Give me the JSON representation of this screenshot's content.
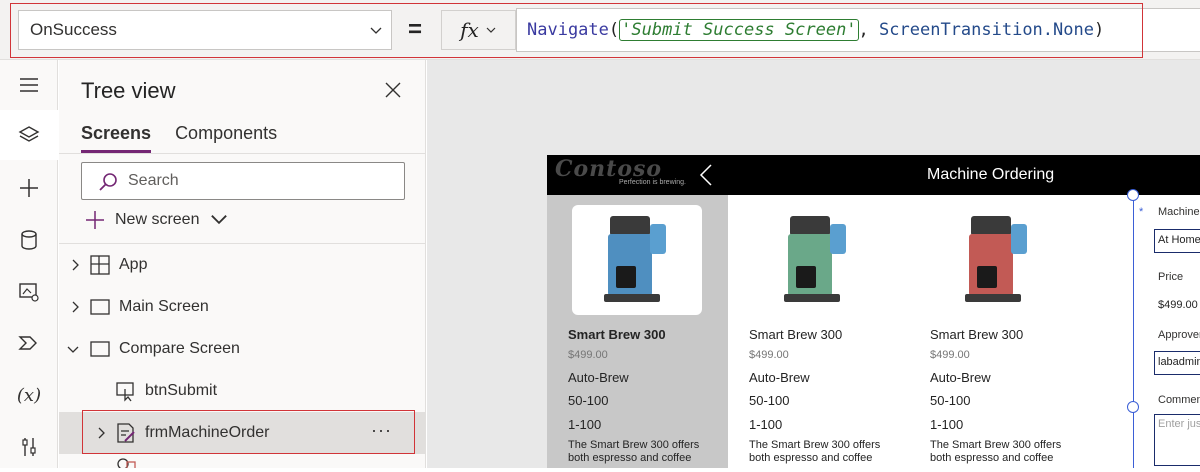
{
  "formula_bar": {
    "property": "OnSuccess",
    "equals": "=",
    "fx_label": "fx",
    "formula": {
      "fn": "Navigate",
      "open": "(",
      "arg1": "'Submit Success Screen'",
      "comma": ", ",
      "arg2": "ScreenTransition.None",
      "close": ")"
    }
  },
  "rail": {
    "items": [
      "menu-icon",
      "layers-icon",
      "plus-icon",
      "database-icon",
      "media-icon",
      "power-automate-icon",
      "variables-icon",
      "tools-icon"
    ],
    "variables_text": "(x)"
  },
  "tree_view": {
    "title": "Tree view",
    "tabs": [
      {
        "label": "Screens"
      },
      {
        "label": "Components"
      }
    ],
    "search_placeholder": "Search",
    "new_screen": "New screen",
    "nodes": [
      {
        "label": "App"
      },
      {
        "label": "Main Screen"
      },
      {
        "label": "Compare Screen"
      },
      {
        "label": "btnSubmit"
      },
      {
        "label": "frmMachineOrder",
        "more": "···"
      }
    ]
  },
  "app": {
    "logo": "Contoso",
    "tagline": "Perfection is brewing.",
    "title": "Machine Ordering",
    "products": [
      {
        "name": "Smart Brew 300",
        "price": "$499.00",
        "brew": "Auto-Brew",
        "range1": "50-100",
        "range2": "1-100",
        "desc1": "The Smart Brew 300 offers",
        "desc2": "both espresso and coffee",
        "color": "#4f8fc0"
      },
      {
        "name": "Smart Brew 300",
        "price": "$499.00",
        "brew": "Auto-Brew",
        "range1": "50-100",
        "range2": "1-100",
        "desc1": "The Smart Brew 300 offers",
        "desc2": "both espresso and coffee",
        "color": "#6aa889"
      },
      {
        "name": "Smart Brew 300",
        "price": "$499.00",
        "brew": "Auto-Brew",
        "range1": "50-100",
        "range2": "1-100",
        "desc1": "The Smart Brew 300 offers",
        "desc2": "both espresso and coffee",
        "color": "#c25a55"
      }
    ],
    "form": {
      "required": "*",
      "machine_label": "Machine",
      "machine_value": "At Home",
      "price_label": "Price",
      "price_value": "$499.00",
      "approver_label": "Approver",
      "approver_value": "labadmin",
      "comments_label": "Comments",
      "comments_placeholder": "Enter just"
    }
  }
}
